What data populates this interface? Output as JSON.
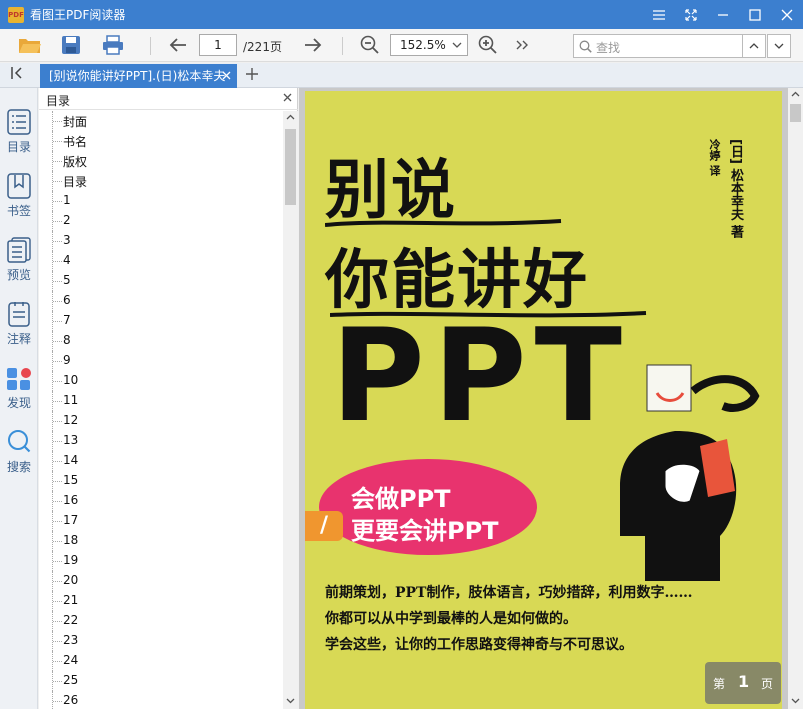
{
  "window": {
    "title": "看图王PDF阅读器",
    "logo_text": "PDF"
  },
  "toolbar": {
    "page_current": "1",
    "page_total": "/221页",
    "zoom": "152.5%",
    "search_placeholder": "查找"
  },
  "tab": {
    "label": "[别说你能讲好PPT].(日)松本幸夫"
  },
  "rail": {
    "items": [
      {
        "label": "目录",
        "icon": "toc-icon"
      },
      {
        "label": "书签",
        "icon": "bookmark-icon"
      },
      {
        "label": "预览",
        "icon": "preview-icon"
      },
      {
        "label": "注释",
        "icon": "annotation-icon"
      },
      {
        "label": "发现",
        "icon": "discover-icon"
      },
      {
        "label": "搜索",
        "icon": "search-icon"
      }
    ]
  },
  "outline": {
    "title": "目录",
    "items": [
      "封面",
      "书名",
      "版权",
      "目录",
      "1",
      "2",
      "3",
      "4",
      "5",
      "6",
      "7",
      "8",
      "9",
      "10",
      "11",
      "12",
      "13",
      "14",
      "15",
      "16",
      "17",
      "18",
      "19",
      "20",
      "21",
      "22",
      "23",
      "24",
      "25",
      "26"
    ]
  },
  "cover": {
    "title_line1": "别说",
    "title_line2": "你能讲好",
    "title_ppt": "PPT",
    "author": "[日] 松本幸夫 著",
    "translator": "冷婷 译",
    "oval_line1": "会做PPT",
    "oval_line2": "更要会讲PPT",
    "slash": "/",
    "body_lines": [
      "前期策划，PPT制作，肢体语言，巧妙措辞，利用数字……",
      "你都可以从中学到最棒的人是如何做的。",
      "学会这些，让你的工作思路变得神奇与不可思议。"
    ]
  },
  "page_badge": {
    "prefix": "第",
    "number": "1",
    "suffix": "页"
  },
  "colors": {
    "titlebar": "#3c7fcf",
    "cover_bg": "#d8d955",
    "oval": "#e8336e",
    "accent_orange": "#f0962f"
  }
}
